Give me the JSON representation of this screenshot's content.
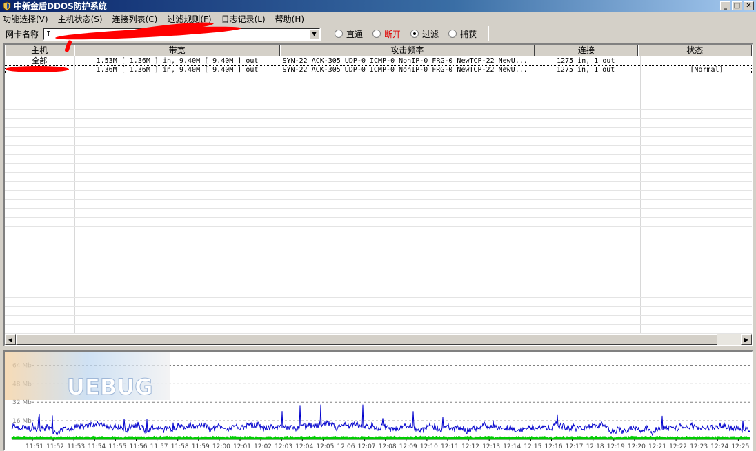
{
  "window": {
    "title": "中新金盾DDOS防护系统",
    "controls": {
      "minimize": "_",
      "maximize": "□",
      "close": "✕"
    }
  },
  "menu": [
    "功能选择(V)",
    "主机状态(S)",
    "连接列表(C)",
    "过滤规则(F)",
    "日志记录(L)",
    "帮助(H)"
  ],
  "toolbar": {
    "nic_label": "网卡名称",
    "nic_value": "I",
    "modes": [
      {
        "label": "直通",
        "checked": false,
        "color": "#000000"
      },
      {
        "label": "断开",
        "checked": false,
        "color": "#e00000"
      },
      {
        "label": "过滤",
        "checked": true,
        "color": "#000000"
      },
      {
        "label": "捕获",
        "checked": false,
        "color": "#000000"
      }
    ]
  },
  "table": {
    "columns": [
      "主机",
      "带宽",
      "攻击频率",
      "连接",
      "状态"
    ],
    "rows": [
      {
        "host": "全部",
        "bandwidth": "1.53M [ 1.36M ] in, 9.40M [ 9.40M ] out",
        "attack": "SYN-22 ACK-305 UDP-0 ICMP-0 NonIP-0 FRG-0 NewTCP-22 NewU...",
        "conn": "1275 in, 1 out",
        "status": ""
      },
      {
        "host": "",
        "bandwidth": "1.36M [ 1.36M ] in, 9.40M [ 9.40M ] out",
        "attack": "SYN-22 ACK-305 UDP-0 ICMP-0 NonIP-0 FRG-0 NewTCP-22 NewU...",
        "conn": "1275 in, 1 out",
        "status": "[Normal]"
      }
    ]
  },
  "chart_data": {
    "type": "line",
    "y_ticks": [
      "64 Mb",
      "48 Mb",
      "32 Mb",
      "16 Mb"
    ],
    "ylim": [
      0,
      72
    ],
    "x_ticks": [
      "11:51",
      "11:52",
      "11:53",
      "11:54",
      "11:55",
      "11:56",
      "11:57",
      "11:58",
      "11:59",
      "12:00",
      "12:01",
      "12:02",
      "12:03",
      "12:04",
      "12:05",
      "12:06",
      "12:07",
      "12:08",
      "12:09",
      "12:10",
      "12:11",
      "12:12",
      "12:13",
      "12:14",
      "12:15",
      "12:16",
      "12:17",
      "12:18",
      "12:19",
      "12:20",
      "12:21",
      "12:22",
      "12:23",
      "12:24",
      "12:25"
    ],
    "grid": true,
    "series": [
      {
        "color": "#0000cc",
        "approx_level_mb": 10,
        "approx_peak_mb": 30
      },
      {
        "color": "#00cc00",
        "approx_level_mb": 2
      }
    ]
  },
  "watermark": {
    "text": "UEBUG"
  },
  "colors": {
    "redaction": "#ff0000"
  }
}
